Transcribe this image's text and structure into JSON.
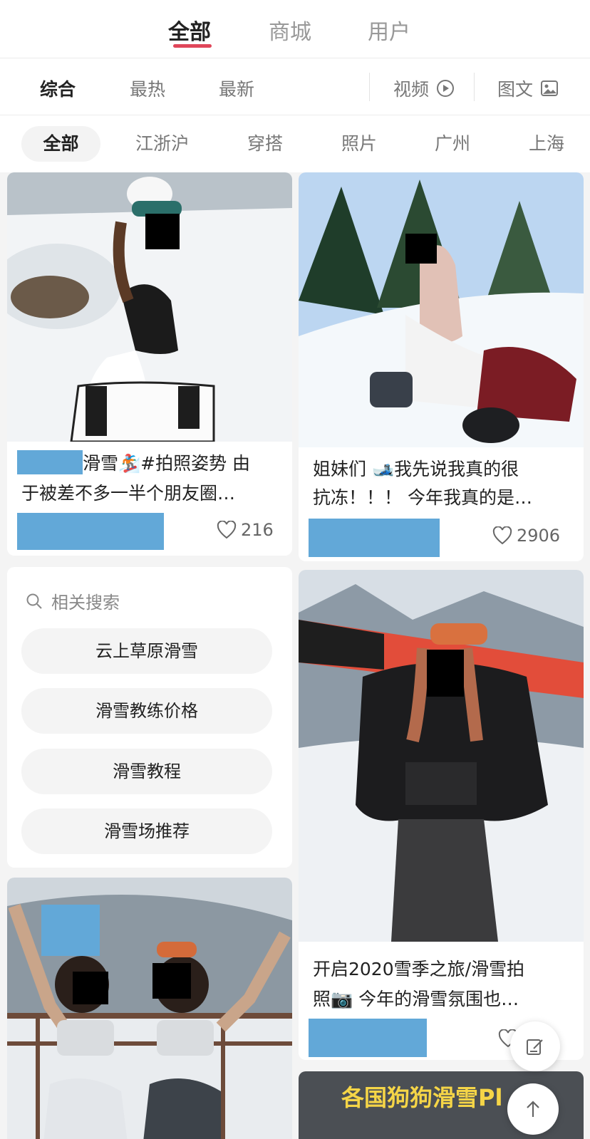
{
  "top_tabs": [
    "全部",
    "商城",
    "用户"
  ],
  "sort": {
    "options": [
      "综合",
      "最热",
      "最新"
    ],
    "video_label": "视频",
    "image_text_label": "图文"
  },
  "filters": [
    "全部",
    "江浙沪",
    "穿搭",
    "照片",
    "广州",
    "上海"
  ],
  "posts": [
    {
      "title_line1": "滑雪🏂#拍照姿势 由",
      "title_line2": "于被差不多一半个朋友圈…",
      "likes": "216"
    },
    {
      "title_line1": "姐妹们 🎿我先说我真的很",
      "title_line2": "抗冻！！！ 今年我真的是…",
      "likes": "2906"
    },
    {
      "title_line1": "开启2020雪季之旅/滑雪拍",
      "title_line2": "照📷 今年的滑雪氛围也…"
    },
    {
      "banner_text": "各国狗狗滑雪Pl"
    }
  ],
  "related": {
    "heading": "相关搜索",
    "items": [
      "云上草原滑雪",
      "滑雪教练价格",
      "滑雪教程",
      "滑雪场推荐"
    ]
  },
  "colors": {
    "accent": "#e0465a",
    "placeholder_block": "#62a8d8"
  }
}
